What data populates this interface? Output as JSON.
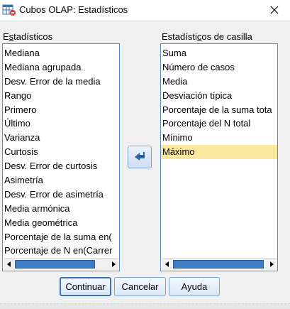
{
  "window": {
    "title": "Cubos OLAP: Estadísticos",
    "close_glyph": "✕"
  },
  "left_panel": {
    "label_before": "E",
    "label_underlined": "s",
    "label_after": "tadísticos",
    "items": [
      "Mediana",
      "Mediana agrupada",
      "Desv. Error de la media",
      "Rango",
      "Primero",
      "Último",
      "Varianza",
      "Curtosis",
      "Desv. Error de curtosis",
      "Asimetría",
      "Desv. Error de asimetría",
      "Media armónica",
      "Media geométrica",
      "Porcentaje de la suma en(",
      "Porcentaje de N en(Carrer"
    ]
  },
  "right_panel": {
    "label_before": "Estadísti",
    "label_underlined": "c",
    "label_after": "os de casilla",
    "items": [
      "Suma",
      "Número de casos",
      "Media",
      "Desviación típica",
      "Porcentaje de la suma tota",
      "Porcentaje del N total",
      "Mínimo",
      "Máximo"
    ],
    "selected_index": 7
  },
  "buttons": {
    "continue": "Continuar",
    "cancel": "Cancelar",
    "help": "Ayuda"
  },
  "icons": {
    "app": "spss-table-icon",
    "move": "move-left-arrow-icon",
    "close": "close-icon"
  },
  "colors": {
    "selection": "#fbe79f",
    "accent": "#3f7cc8",
    "listbox_border": "#5a8cc8"
  }
}
